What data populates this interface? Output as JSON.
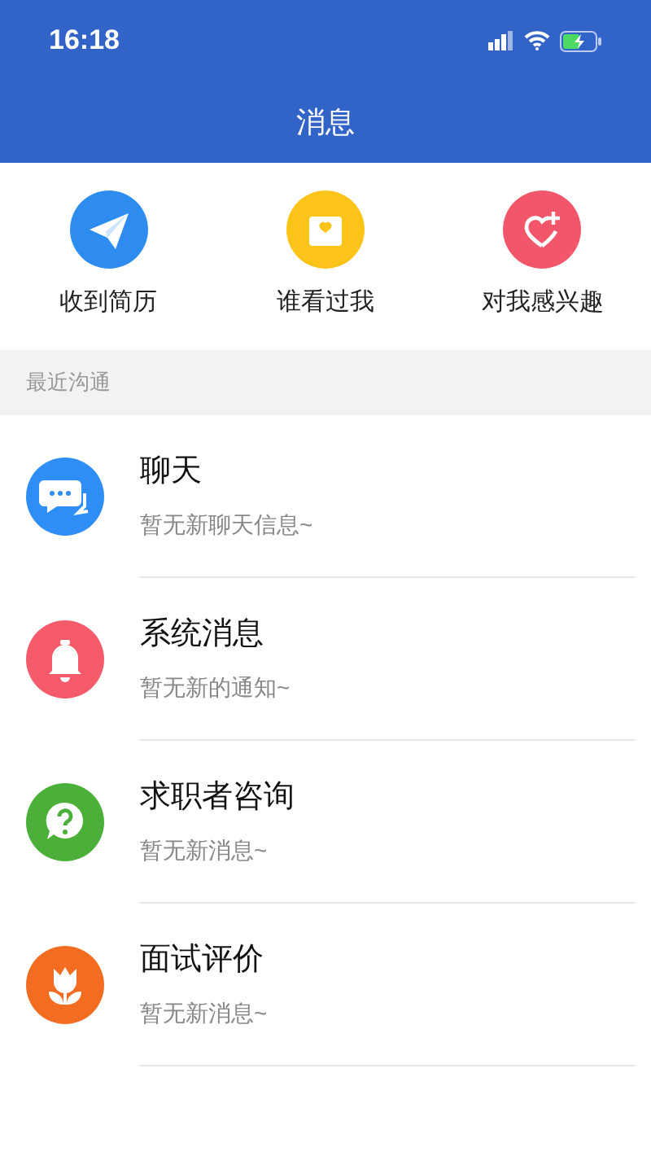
{
  "status_bar": {
    "time": "16:18"
  },
  "header": {
    "title": "消息"
  },
  "quick_actions": [
    {
      "kind": "plane",
      "label": "收到简历"
    },
    {
      "kind": "envelope",
      "label": "谁看过我"
    },
    {
      "kind": "heart",
      "label": "对我感兴趣"
    }
  ],
  "section": {
    "title": "最近沟通"
  },
  "conversations": [
    {
      "kind": "chat",
      "title": "聊天",
      "subtitle": "暂无新聊天信息~"
    },
    {
      "kind": "bell",
      "title": "系统消息",
      "subtitle": "暂无新的通知~"
    },
    {
      "kind": "question",
      "title": "求职者咨询",
      "subtitle": "暂无新消息~"
    },
    {
      "kind": "flower",
      "title": "面试评价",
      "subtitle": "暂无新消息~"
    }
  ]
}
